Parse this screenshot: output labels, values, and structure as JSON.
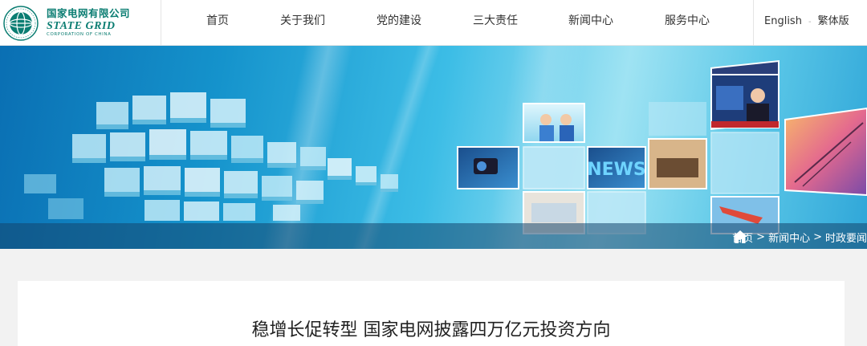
{
  "header": {
    "logo": {
      "name_cn": "国家电网有限公司",
      "name_en": "STATE GRID",
      "sub_en": "CORPORATION OF CHINA"
    },
    "nav": [
      {
        "label": "首页"
      },
      {
        "label": "关于我们"
      },
      {
        "label": "党的建设"
      },
      {
        "label": "三大责任"
      },
      {
        "label": "新闻中心"
      },
      {
        "label": "服务中心"
      }
    ],
    "lang": {
      "english": "English",
      "separator": "-",
      "traditional": "繁体版"
    }
  },
  "banner": {
    "tiles": {
      "news_word": "NEWS"
    },
    "breadcrumb": {
      "home_icon": "home-icon",
      "items": [
        "首页",
        "新闻中心",
        "时政要闻"
      ],
      "separator": ">"
    }
  },
  "article": {
    "title": "稳增长促转型 国家电网披露四万亿元投资方向"
  },
  "colors": {
    "brand": "#0b7d72",
    "banner_blue": "#1593cc",
    "crumb_bar": "#14466e"
  }
}
